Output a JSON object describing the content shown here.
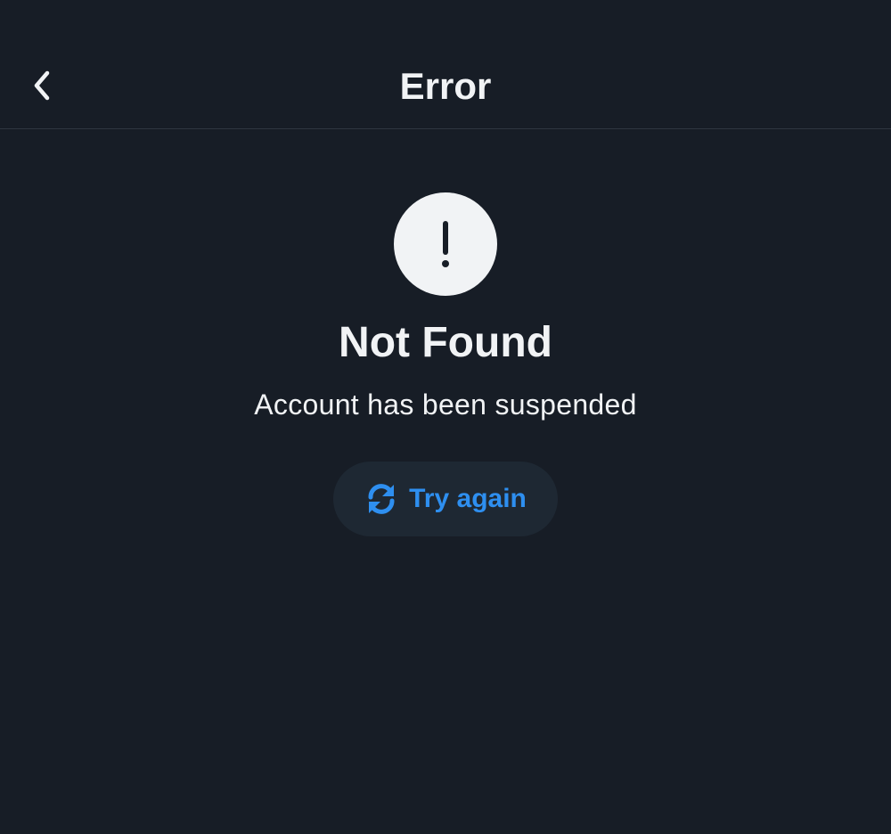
{
  "header": {
    "title": "Error",
    "back_icon": "chevron-left-icon"
  },
  "error": {
    "icon": "exclamation-icon",
    "title": "Not Found",
    "message": "Account has been suspended"
  },
  "retry": {
    "icon": "refresh-icon",
    "label": "Try again"
  },
  "colors": {
    "background": "#171d26",
    "text": "#f1f3f5",
    "accent": "#2e8ff0",
    "button_bg": "#1e2833",
    "divider": "#2f3640"
  }
}
